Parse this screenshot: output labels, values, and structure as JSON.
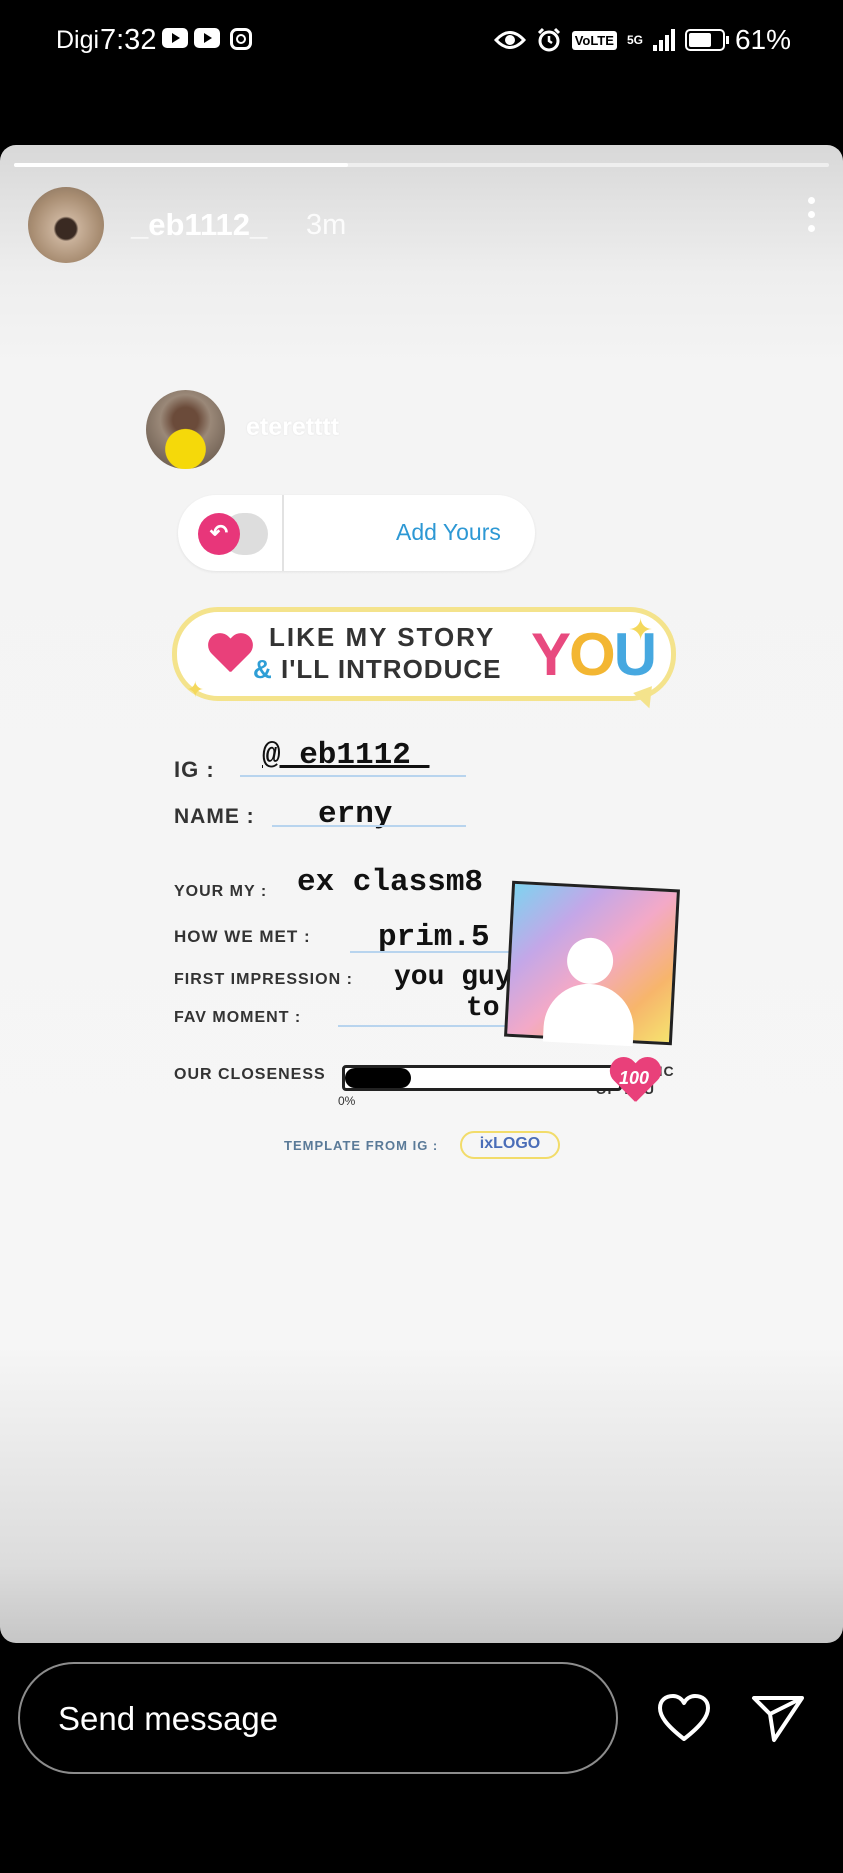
{
  "status_bar": {
    "carrier": "Digi",
    "time": "7:32",
    "network": "VoLTE",
    "net_gen": "5G",
    "battery": "61%"
  },
  "story": {
    "progress": 0.41,
    "username": "_eb1112_",
    "age": "3m",
    "mention_username": "eteretttt",
    "add_yours_label": "Add Yours"
  },
  "template": {
    "banner_line1": "LIKE MY STORY",
    "banner_amp": "&",
    "banner_line2": "I'LL INTRODUCE",
    "banner_you": [
      "Y",
      "O",
      "U"
    ],
    "ig_label": "IG :",
    "ig_value": "@_eb1112_",
    "name_label": "NAME :",
    "name_value": "erny",
    "your_my_label": "YOUR MY :",
    "your_my_value": "ex classm8",
    "how_met_label": "HOW WE MET :",
    "how_met_value": "prim.5",
    "first_impression_label": "FIRST IMPRESSION :",
    "first_impression_value": "you guys gossip",
    "fav_moment_label": "FAV MOMENT :",
    "fav_moment_value": "to loud",
    "closeness_label": "OUR CLOSENESS",
    "closeness_min": "0%",
    "closeness_max": "100",
    "closeness_level": 0.24,
    "fav_pic_note_line1": ": MY FAV PIC",
    "fav_pic_note_line2": "OF YOU",
    "credit_text": "TEMPLATE FROM IG :",
    "credit_logo": "ixLOGO"
  },
  "bottom_bar": {
    "message_placeholder": "Send message"
  },
  "colors": {
    "accent_pink": "#e9407a",
    "add_yours_blue": "#2d98d4",
    "banner_border": "#f4e38c"
  },
  "icons": {
    "like": "heart-outline-icon",
    "share": "paper-plane-icon",
    "more": "more-vertical-icon"
  }
}
